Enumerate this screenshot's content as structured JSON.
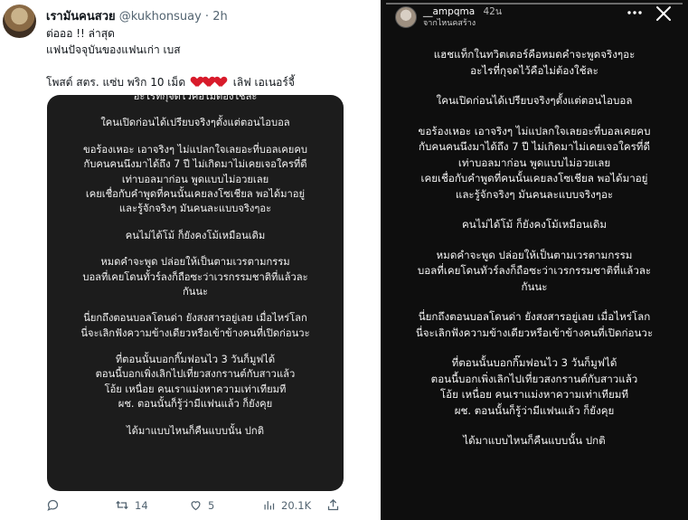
{
  "tweet": {
    "display_name": "เรามันคนสวย",
    "handle": "@kukhonsuay",
    "separator": "·",
    "time": "2h",
    "text_lines": [
      "ต่อออ !! ล่าสุด",
      "แฟนปัจจุบันของแฟนเก่า เบส"
    ],
    "caption_before": "โพสต์ สตร. แซ่บ พริก 10 เม็ด",
    "caption_after": "เลิฟ เอเนอร์จี้",
    "media_lines": [
      "อะไรที่กุจดไว้คือไม่ต้องใช้ละ",
      "",
      "ใคนเปิดก่อนได้เปรียบจริงๆตั้งแต่ตอนไอบอล",
      "",
      "ขอร้องเหอะ เอาจริงๆ ไม่แปลกใจเลยอะที่บอลเคยคบ",
      "กับคนคนนึงมาได้ถึง 7 ปี ไม่เกิดมาไม่เคยเจอใครที่ดี",
      "เท่าบอลมาก่อน พูดแบบไม่อวยเลย",
      "เคยเชื่อกับคำพูดที่คนนั้นเคยลงโซเชียล พอได้มาอยู่",
      "และรู้จักจริงๆ มันคนละแบบจริงๆอะ",
      "",
      "คนไม่ได้โม้ ก็ยังคงโม้เหมือนเดิม",
      "",
      "หมดคำจะพูด ปล่อยให้เป็นตามเวรตามกรรม",
      "บอลที่เคยโดนทั้วร์ลงก็ถือซะว่าเวรกรรมชาติที่แล้วละ",
      "กันนะ",
      "",
      "นี่ยกถึงตอนบอลโดนด่า ยังสงสารอยู่เลย เมื่อไหร่โลก",
      "นี่จะเลิกฟังความข้างเดียวหรือเข้าข้างคนที่เปิดก่อนวะ",
      "",
      "ที่ตอนนั้นบอกกิ๊มฟอนไว 3 วันก็มูฟได้",
      "ตอนนี้บอกเพิ่งเลิกไปเที่ยวสงกรานต์กับสาวแล้ว",
      "โอ้ย เหนื่อย คนเราแม่งหาความเท่าเทียมที",
      "ผช. ตอนนั้นก็รู้ว่ามีแฟนแล้ว ก็ยังคุย",
      "",
      "ได้มาแบบไหนก็คืนแบบนั้น ปกติ"
    ],
    "actions": {
      "reply_count": "",
      "retweet_count": "14",
      "like_count": "5",
      "view_count": "20.1K"
    }
  },
  "story": {
    "username": "__ampqma",
    "age": "42น",
    "subtitle": "จากไหนคสร้าง",
    "lines": [
      "แฮชแท็กในทวิตเตอร์คือหมดคำจะพูดจริงๆอะ",
      "อะไรที่กุจดไว้คือไม่ต้องใช้ละ",
      "",
      "ใคนเปิดก่อนได้เปรียบจริงๆตั้งแต่ตอนไอบอล",
      "",
      "ขอร้องเหอะ เอาจริงๆ ไม่แปลกใจเลยอะที่บอลเคยคบ",
      "กับคนคนนึงมาได้ถึง 7 ปี ไม่เกิดมาไม่เคยเจอใครที่ดี",
      "เท่าบอลมาก่อน พูดแบบไม่อวยเลย",
      "เคยเชื่อกับคำพูดที่คนนั้นเคยลงโซเชียล พอได้มาอยู่",
      "และรู้จักจริงๆ มันคนละแบบจริงๆอะ",
      "",
      "คนไม่ได้โม้ ก็ยังคงโม้เหมือนเดิม",
      "",
      "หมดคำจะพูด ปล่อยให้เป็นตามเวรตามกรรม",
      "บอลที่เคยโดนทัวร์ลงก็ถือซะว่าเวรกรรมชาติที่แล้วละ",
      "กันนะ",
      "",
      "นี่ยกถึงตอนบอลโดนด่า ยังสงสารอยู่เลย เมื่อไหร่โลก",
      "นี่จะเลิกฟังความข้างเดียวหรือเข้าข้างคนที่เปิดก่อนวะ",
      "",
      "ที่ตอนนั้นบอกกิ๊มฟอนไว 3 วันก็มูฟได้",
      "ตอนนี้บอกเพิ่งเลิกไปเที่ยวสงกรานต์กับสาวแล้ว",
      "โอ้ย เหนื่อย คนเราแม่งหาความเท่าเทียมที",
      "ผช. ตอนนั้นก็รู้ว่ามีแฟนแล้ว ก็ยังคุย",
      "",
      "ได้มาแบบไหนก็คืนแบบนั้น ปกติ"
    ]
  },
  "icons": {
    "reply": "speech-bubble-icon",
    "retweet": "retweet-icon",
    "like": "heart-outline-icon",
    "views": "bar-chart-icon",
    "share": "share-icon",
    "more": "more-dots-icon",
    "close": "close-icon",
    "hearts": "red-heart-icon"
  },
  "colors": {
    "heart": "#d81b2b",
    "story_bg": "#0e0e0e",
    "media_bg": "#1c1c1c",
    "muted_text": "#536471"
  }
}
